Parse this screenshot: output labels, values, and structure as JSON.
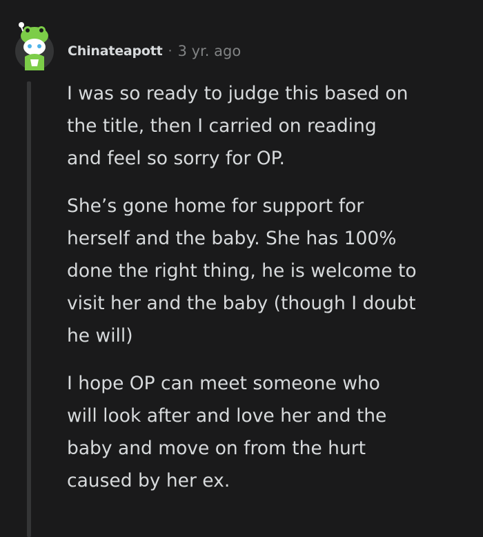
{
  "comment": {
    "author": "Chinateapott",
    "separator": "·",
    "timestamp": "3 yr. ago",
    "paragraphs": [
      "I was so ready to judge this based on\nthe title, then I carried on reading\nand feel so sorry for OP.",
      "She’s gone home for support for\nherself and the baby. She has 100%\ndone the right thing, he is welcome to\nvisit her and the baby (though I doubt\nhe will)",
      "I hope OP can meet someone who\nwill look after and love her and the\nbaby and move on from the hurt\ncaused by her ex."
    ]
  },
  "colors": {
    "background": "#1a1a1b",
    "text": "#d7dadc",
    "muted": "#818384",
    "thread_line": "#343536",
    "avatar_bg": "#343536",
    "avatar_green": "#7ccd48"
  },
  "icons": {
    "avatar": "snoo-frog-hat-avatar-icon"
  }
}
